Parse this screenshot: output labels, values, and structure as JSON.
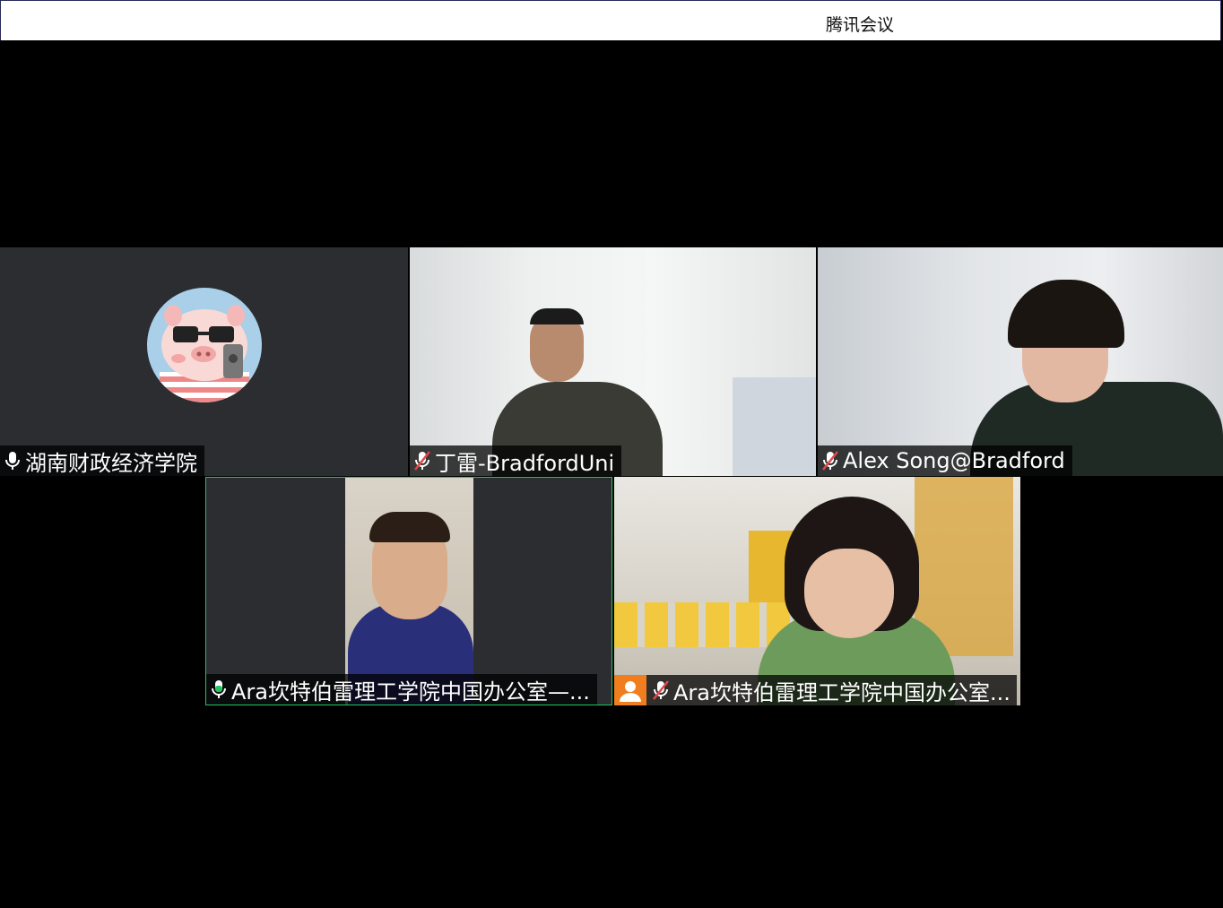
{
  "window": {
    "title": "腾讯会议"
  },
  "participants": [
    {
      "name": "湖南财政经济学院",
      "mic": "on",
      "camera": "off",
      "avatar": "pig-avatar"
    },
    {
      "name": "丁雷-BradfordUni",
      "mic": "muted",
      "camera": "on"
    },
    {
      "name": "Alex Song@Bradford",
      "mic": "muted",
      "camera": "on"
    },
    {
      "name": "Ara坎特伯雷理工学院中国办公室—...",
      "mic": "speaking",
      "camera": "on",
      "active_speaker": true
    },
    {
      "name": "Ara坎特伯雷理工学院中国办公室...",
      "mic": "muted",
      "camera": "on",
      "badge": "host-user-icon"
    }
  ],
  "colors": {
    "speaking": "#22c55e",
    "muted": "#e04848",
    "badge": "#f07d1e",
    "tile_bg": "#2b2d31"
  }
}
